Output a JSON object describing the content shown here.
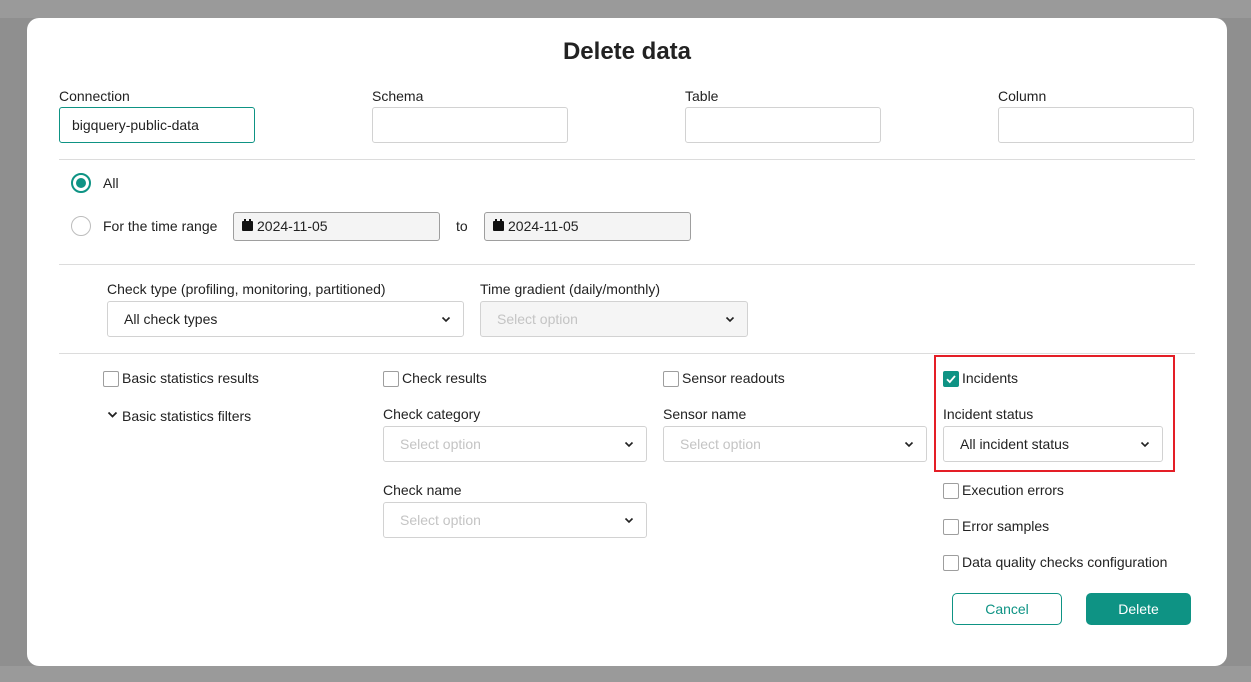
{
  "dialog": {
    "title": "Delete data",
    "connection": {
      "label": "Connection",
      "value": "bigquery-public-data"
    },
    "schema": {
      "label": "Schema",
      "value": ""
    },
    "table": {
      "label": "Table",
      "value": ""
    },
    "column": {
      "label": "Column",
      "value": ""
    },
    "range": {
      "all_label": "All",
      "time_range_label": "For the time range",
      "from": "2024-11-05",
      "to_label": "to",
      "to": "2024-11-05",
      "selected": "All"
    },
    "check_type": {
      "label": "Check type (profiling, monitoring, partitioned)",
      "value": "All check types"
    },
    "time_gradient": {
      "label": "Time gradient (daily/monthly)",
      "placeholder": "Select option"
    },
    "basic_statistics_results": {
      "label": "Basic statistics results",
      "checked": false
    },
    "basic_statistics_filters": {
      "label": "Basic statistics filters"
    },
    "check_results": {
      "label": "Check results",
      "checked": false
    },
    "check_category": {
      "label": "Check category",
      "placeholder": "Select option"
    },
    "check_name": {
      "label": "Check name",
      "placeholder": "Select option"
    },
    "sensor_readouts": {
      "label": "Sensor readouts",
      "checked": false
    },
    "sensor_name": {
      "label": "Sensor name",
      "placeholder": "Select option"
    },
    "incidents": {
      "label": "Incidents",
      "checked": true
    },
    "incident_status": {
      "label": "Incident status",
      "value": "All incident status"
    },
    "execution_errors": {
      "label": "Execution errors",
      "checked": false
    },
    "error_samples": {
      "label": "Error samples",
      "checked": false
    },
    "dq_checks_config": {
      "label": "Data quality checks configuration",
      "checked": false
    },
    "buttons": {
      "cancel": "Cancel",
      "delete": "Delete"
    }
  },
  "colors": {
    "accent": "#0e9384",
    "highlight": "#e41e26"
  }
}
